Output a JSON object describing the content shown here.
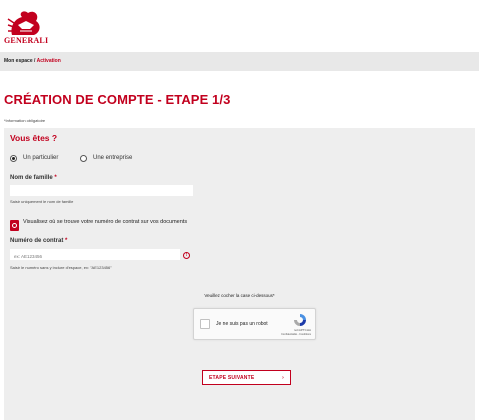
{
  "header": {
    "brand": "GENERALI"
  },
  "breadcrumb": {
    "home": "Mon espace",
    "sep": " / ",
    "current": "Activation"
  },
  "page": {
    "title": "CRÉATION DE COMPTE - ETAPE 1/3",
    "required_note": "*Information obligatoire"
  },
  "form": {
    "section_title": "Vous êtes ?",
    "radio_particulier": "Un particulier",
    "radio_entreprise": "Une entreprise",
    "selected": "Un particulier",
    "nom_label": "Nom de famille",
    "req_mark": "*",
    "nom_value": "",
    "nom_helper": "Saisir uniquement le nom de famille",
    "help_link": "Visualisez où se trouve votre numéro de contrat sur vos documents",
    "contrat_label": "Numéro de contrat",
    "contrat_placeholder": "ex: AE123456",
    "contrat_helper": "Saisir le numéro sans y inclure d'espace, ex: \"AE123456\"",
    "warn_symbol": "!"
  },
  "captcha": {
    "prompt": "Veuillez cocher la case ci-dessous*",
    "label": "Je ne suis pas un robot",
    "brand": "reCAPTCHA",
    "links": "Confidentialité - Conditions"
  },
  "actions": {
    "next_label": "ETAPE SUIVANTE",
    "next_arrow": "›"
  },
  "colors": {
    "accent": "#c2001e",
    "panel": "#eeeeee",
    "breadcrumb_bg": "#e8e8e8"
  },
  "icons": {
    "logo": "generali-lion-logo",
    "doc": "document-search-icon",
    "warn": "warning-icon",
    "recaptcha": "recaptcha-icon"
  }
}
